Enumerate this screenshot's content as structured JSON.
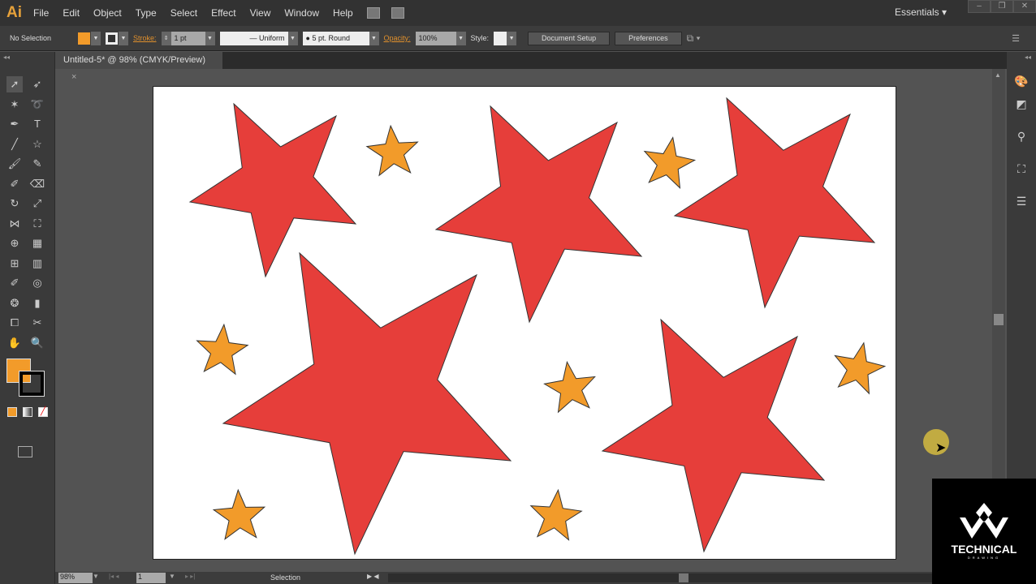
{
  "app": {
    "logo": "Ai",
    "menus": [
      "File",
      "Edit",
      "Object",
      "Type",
      "Select",
      "Effect",
      "View",
      "Window",
      "Help"
    ],
    "workspace": "Essentials"
  },
  "control": {
    "selection": "No Selection",
    "fill_color": "#f29b2a",
    "stroke_label": "Stroke:",
    "stroke_weight": "1 pt",
    "profile": "Uniform",
    "brush": "5 pt. Round",
    "opacity_label": "Opacity:",
    "opacity": "100%",
    "style_label": "Style:",
    "document_setup": "Document Setup",
    "preferences": "Preferences"
  },
  "document": {
    "tab_title": "Untitled-5* @ 98% (CMYK/Preview)",
    "close": "×"
  },
  "status": {
    "zoom": "98%",
    "artboard": "1",
    "tool": "Selection"
  },
  "artwork": {
    "red": "#e63e3a",
    "orange": "#f29b2a",
    "large_stars": 5,
    "small_stars": 7
  },
  "brand": {
    "name": "TECHNICAL",
    "sub": "DRAWING"
  }
}
